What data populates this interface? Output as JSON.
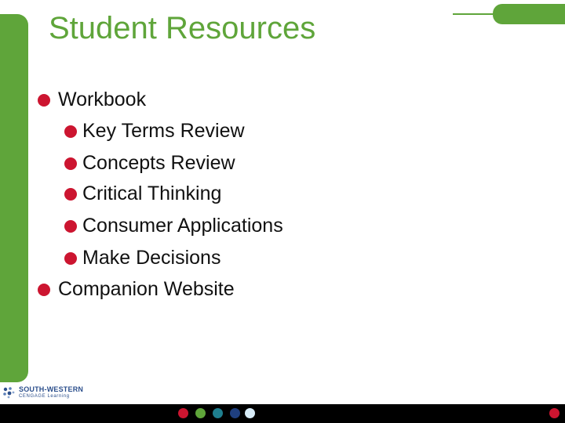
{
  "slide": {
    "title": "Student Resources",
    "bullets": [
      {
        "text": "Workbook",
        "level": 1
      },
      {
        "text": "Key Terms Review",
        "level": 2
      },
      {
        "text": "Concepts Review",
        "level": 2
      },
      {
        "text": "Critical Thinking",
        "level": 2
      },
      {
        "text": "Consumer Applications",
        "level": 2
      },
      {
        "text": "Make Decisions",
        "level": 2
      },
      {
        "text": "Companion Website",
        "level": 1
      }
    ]
  },
  "logo": {
    "line1": "SOUTH-WESTERN",
    "line2": "CENGAGE Learning"
  },
  "colors": {
    "accent_green": "#5fa53a",
    "bullet_red": "#cc1530",
    "footer_dots": [
      "#cc1530",
      "#5fa53a",
      "#1f7f8f",
      "#1f3f7f",
      "#d8ecf8"
    ],
    "footer_right_dot": "#cc1530"
  }
}
